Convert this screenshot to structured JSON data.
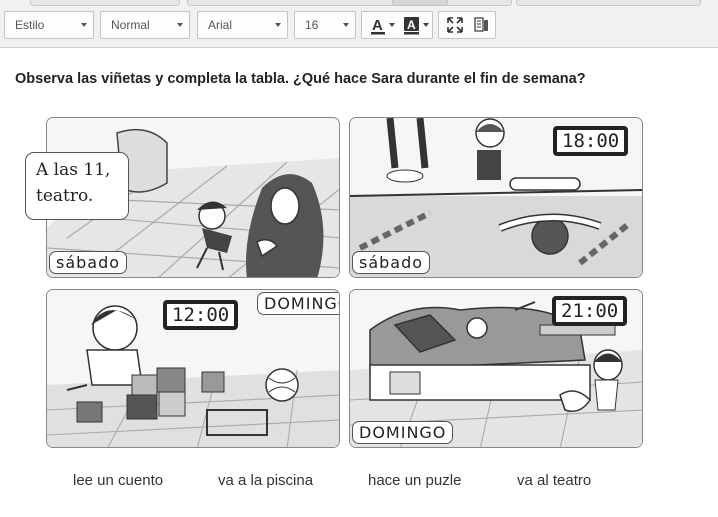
{
  "toolbar": {
    "style_select": "Estilo",
    "format_select": "Normal",
    "font_select": "Arial",
    "size_select": "16",
    "text_color_icon": "text-color-icon",
    "bg_color_icon": "background-color-icon",
    "maximize_icon": "maximize-icon",
    "show_blocks_icon": "show-blocks-icon"
  },
  "instruction": "Observa las viñetas y completa la tabla. ¿Qué hace Sara durante el fin de semana?",
  "panels": [
    {
      "caption": "sábado",
      "bubble_line1": "A las 11,",
      "bubble_line2": "teatro."
    },
    {
      "caption": "sábado",
      "clock": "18:00"
    },
    {
      "caption": "DOMINGO",
      "clock": "12:00"
    },
    {
      "caption": "DOMINGO",
      "clock": "21:00"
    }
  ],
  "answers": [
    "lee un cuento",
    "va a la piscina",
    "hace un puzle",
    "va al teatro"
  ]
}
